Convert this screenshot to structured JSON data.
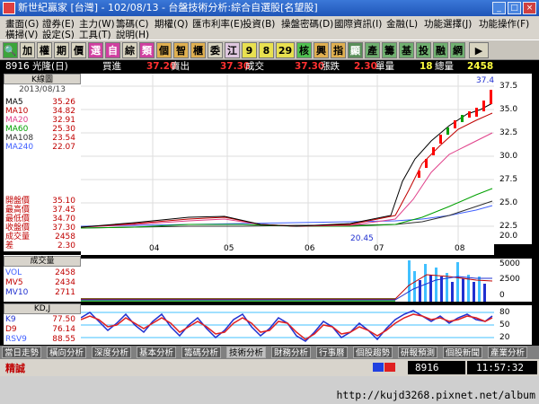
{
  "window": {
    "title": "新世紀贏家 [台灣] - 102/08/13 - 台盤技術分析:綜合自選股[名望股]"
  },
  "menu": {
    "row1": [
      "畫面(G)",
      "證券(E)",
      "主力(W)",
      "籌碼(C)",
      "期權(Q)",
      "匯市利率(E)",
      "投資(B)",
      "操盤密碼(D)",
      "國際資訊(I)",
      "金融(L)",
      "功能選擇(J)",
      "功能操作(F)"
    ],
    "row2": [
      "橫掃(V)",
      "設定(S)",
      "工具(T)",
      "說明(H)"
    ]
  },
  "toolbar": [
    "加",
    "權",
    "期",
    "價",
    "選",
    "自",
    "綜",
    "類",
    "個",
    "智",
    "櫃",
    "委",
    "江",
    "9",
    "8",
    "29",
    "核",
    "興",
    "指",
    "顯",
    "產",
    "籌",
    "基",
    "投",
    "融",
    "網"
  ],
  "quote": {
    "stock": "8916 光隆(日)",
    "buy_label": "買進",
    "buy": "37.20",
    "sell_label": "賣出",
    "sell": "37.30",
    "deal_label": "成交",
    "deal": "37.30",
    "change_label": "漲跌",
    "change": "2.30",
    "single_label": "單量",
    "single": "18",
    "total_label": "總量",
    "total": "2458"
  },
  "left": {
    "title": "K線圖",
    "date": "2013/08/13",
    "ma": [
      {
        "label": "MA5",
        "value": "35.26"
      },
      {
        "label": "MA10",
        "value": "34.82"
      },
      {
        "label": "MA20",
        "value": "32.91"
      },
      {
        "label": "MA60",
        "value": "25.30"
      },
      {
        "label": "MA108",
        "value": "23.54"
      },
      {
        "label": "MA240",
        "value": "22.07"
      }
    ],
    "prices": [
      {
        "label": "開盤價",
        "value": "35.10"
      },
      {
        "label": "最高價",
        "value": "37.45"
      },
      {
        "label": "最低價",
        "value": "34.70"
      },
      {
        "label": "收盤價",
        "value": "37.30"
      },
      {
        "label": "成交量",
        "value": "2458"
      },
      {
        "label": "差",
        "value": "2.30"
      }
    ]
  },
  "price_axis": [
    "37.5",
    "35.0",
    "32.5",
    "30.0",
    "27.5",
    "25.0",
    "22.5",
    "20.0"
  ],
  "price_high_label": "37.45",
  "price_low_label": "20.45",
  "months": [
    "04",
    "05",
    "06",
    "07",
    "08"
  ],
  "volume": {
    "title": "成交量",
    "rows": [
      {
        "label": "VOL",
        "value": "2458"
      },
      {
        "label": "MV5",
        "value": "2434"
      },
      {
        "label": "MV10",
        "value": "2711"
      }
    ],
    "axis": [
      "5000",
      "2500",
      "0"
    ]
  },
  "kd": {
    "title": "KD,J",
    "rows": [
      {
        "label": "K9",
        "value": "77.50"
      },
      {
        "label": "D9",
        "value": "76.14"
      },
      {
        "label": "RSV9",
        "value": "88.55"
      }
    ],
    "axis": [
      "80",
      "50",
      "20"
    ]
  },
  "tabs": [
    "當日走勢",
    "橫向分析",
    "深度分析",
    "基本分析",
    "籌碼分析",
    "技術分析",
    "財務分析",
    "行事曆",
    "個股趨勢",
    "研報預測",
    "個股新聞",
    "產業分析"
  ],
  "active_tab": 5,
  "status": {
    "left": "精誠",
    "code": "8916",
    "time": "11:57:32"
  },
  "watermark": "http://kujd3268.pixnet.net/album",
  "colors": {
    "ma5": "#000000",
    "ma10": "#c00000",
    "ma20": "#e0408a",
    "ma60": "#00a000",
    "ma108": "#303030",
    "ma240": "#4060ff",
    "up": "#ff0000",
    "down": "#00a000",
    "k_line": "#2030d0",
    "d_line": "#e02020"
  }
}
